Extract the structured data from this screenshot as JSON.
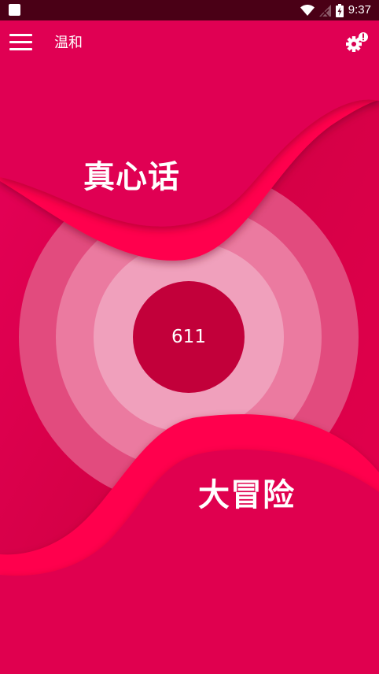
{
  "status_bar": {
    "time": "9:37"
  },
  "toolbar": {
    "title": "温和",
    "menu_icon": "hamburger-menu-icon",
    "settings_icon": "settings-gear-alert-icon"
  },
  "game": {
    "truth_label": "真心话",
    "dare_label": "大冒险",
    "center_count": "611"
  },
  "colors": {
    "background": "#d80048",
    "accent_wave": "#ff004f",
    "center_button": "#c2003a",
    "status_bar": "#4a0016"
  }
}
